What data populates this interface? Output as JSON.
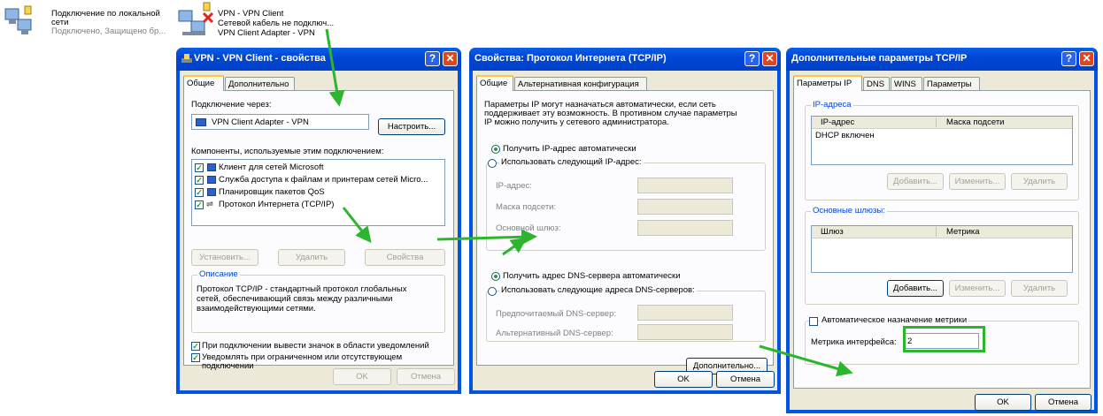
{
  "desktop": {
    "conn1": {
      "name_line1": "Подключение по локальной",
      "name_line2": "сети",
      "status": "Подключено, Защищено бр..."
    },
    "conn2": {
      "name": "VPN - VPN Client",
      "status": "Сетевой кабель не подключ...",
      "device": "VPN Client Adapter - VPN"
    }
  },
  "win1": {
    "title": "VPN - VPN Client - свойства",
    "help": "?",
    "close": "✕",
    "tabs": [
      "Общие",
      "Дополнительно"
    ],
    "connect_via_label": "Подключение через:",
    "adapter_name": "VPN Client Adapter - VPN",
    "configure_btn": "Настроить...",
    "components_label": "Компоненты, используемые этим подключением:",
    "components": [
      "Клиент для сетей Microsoft",
      "Служба доступа к файлам и принтерам сетей Micro...",
      "Планировщик пакетов QoS",
      "Протокол Интернета (TCP/IP)"
    ],
    "install_btn": "Установить...",
    "remove_btn": "Удалить",
    "properties_btn": "Свойства",
    "description_title": "Описание",
    "description_text": [
      "Протокол TCP/IP - стандартный протокол глобальных",
      "сетей, обеспечивающий связь между различными",
      "взаимодействующими сетями."
    ],
    "show_icon_label": "При подключении вывести значок в области уведомлений",
    "notify_label_1": "Уведомлять при ограниченном или отсутствующем",
    "notify_label_2": "подключении",
    "ok": "OK",
    "cancel": "Отмена"
  },
  "win2": {
    "title": "Свойства: Протокол Интернета (TCP/IP)",
    "help": "?",
    "close": "✕",
    "tabs": [
      "Общие",
      "Альтернативная конфигурация"
    ],
    "intro": [
      "Параметры IP могут назначаться автоматически, если сеть",
      "поддерживает эту возможность. В противном случае параметры",
      "IP можно получить у сетевого администратора."
    ],
    "auto_ip": "Получить IP-адрес автоматически",
    "manual_ip": "Использовать следующий IP-адрес:",
    "ip_label": "IP-адрес:",
    "mask_label": "Маска подсети:",
    "gateway_label": "Основной шлюз:",
    "auto_dns": "Получить адрес DNS-сервера автоматически",
    "manual_dns": "Использовать следующие адреса DNS-серверов:",
    "pref_dns": "Предпочитаемый DNS-сервер:",
    "alt_dns": "Альтернативный DNS-сервер:",
    "advanced_btn": "Дополнительно...",
    "ok": "OK",
    "cancel": "Отмена"
  },
  "win3": {
    "title": "Дополнительные параметры TCP/IP",
    "help": "?",
    "close": "✕",
    "tabs": [
      "Параметры IP",
      "DNS",
      "WINS",
      "Параметры"
    ],
    "ip_group": "IP-адреса",
    "ip_col": "IP-адрес",
    "mask_col": "Маска подсети",
    "dhcp_row": "DHCP включен",
    "add_btn": "Добавить...",
    "edit_btn": "Изменить...",
    "remove_btn": "Удалить",
    "gw_group": "Основные шлюзы:",
    "gw_col": "Шлюз",
    "metric_col": "Метрика",
    "gw_add_btn": "Добавить...",
    "gw_edit_btn": "Изменить...",
    "gw_remove_btn": "Удалить",
    "auto_metric": "Автоматическое назначение метрики",
    "if_metric_label": "Метрика интерфейса:",
    "if_metric_value": "2",
    "ok": "OK",
    "cancel": "Отмена"
  },
  "colors": {
    "arrow": "#2db52d",
    "titlebar": "#0054e3",
    "dialog": "#ece9d8"
  }
}
